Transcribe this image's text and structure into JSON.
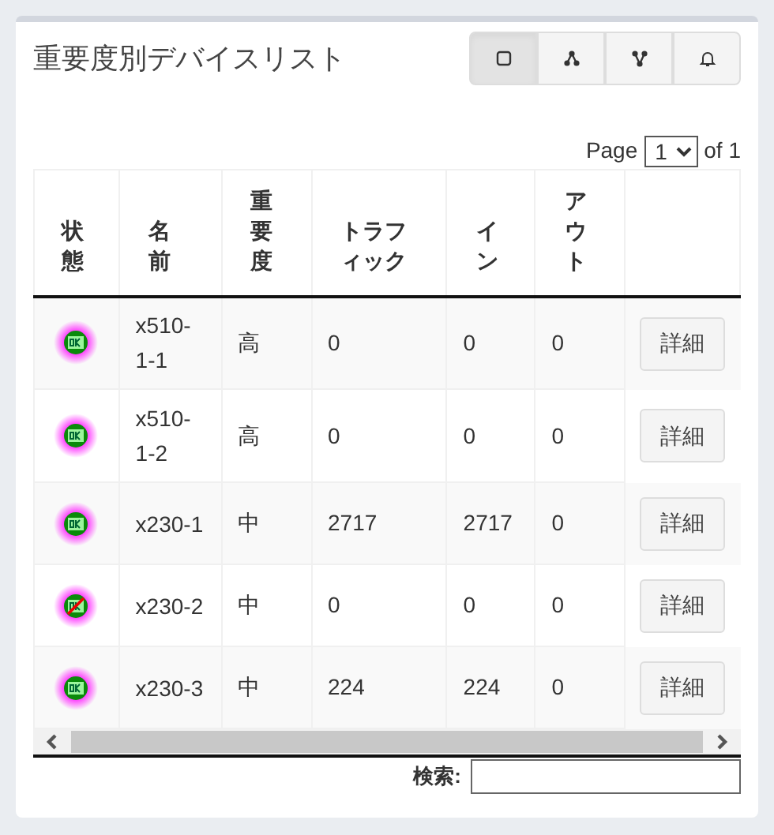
{
  "title": "重要度別デバイスリスト",
  "view_buttons": [
    {
      "kind": "square",
      "selected": true
    },
    {
      "kind": "nodes",
      "selected": false
    },
    {
      "kind": "branch",
      "selected": false
    },
    {
      "kind": "bell",
      "selected": false
    }
  ],
  "pager": {
    "label": "Page",
    "page": "1",
    "of": "of 1"
  },
  "table": {
    "columns": [
      "状態",
      "名前",
      "重要度",
      "トラフィック",
      "イン",
      "アウト"
    ],
    "rows": [
      {
        "online": true,
        "name": "x510-1-1",
        "priority": "高",
        "traffic": "0",
        "in": "0",
        "out": "0",
        "action": "詳細"
      },
      {
        "online": true,
        "name": "x510-1-2",
        "priority": "高",
        "traffic": "0",
        "in": "0",
        "out": "0",
        "action": "詳細"
      },
      {
        "online": true,
        "name": "x230-1",
        "priority": "中",
        "traffic": "2717",
        "in": "2717",
        "out": "0",
        "action": "詳細"
      },
      {
        "online": false,
        "name": "x230-2",
        "priority": "中",
        "traffic": "0",
        "in": "0",
        "out": "0",
        "action": "詳細"
      },
      {
        "online": true,
        "name": "x230-3",
        "priority": "中",
        "traffic": "224",
        "in": "224",
        "out": "0",
        "action": "詳細"
      }
    ]
  },
  "search": {
    "label": "検索:"
  }
}
